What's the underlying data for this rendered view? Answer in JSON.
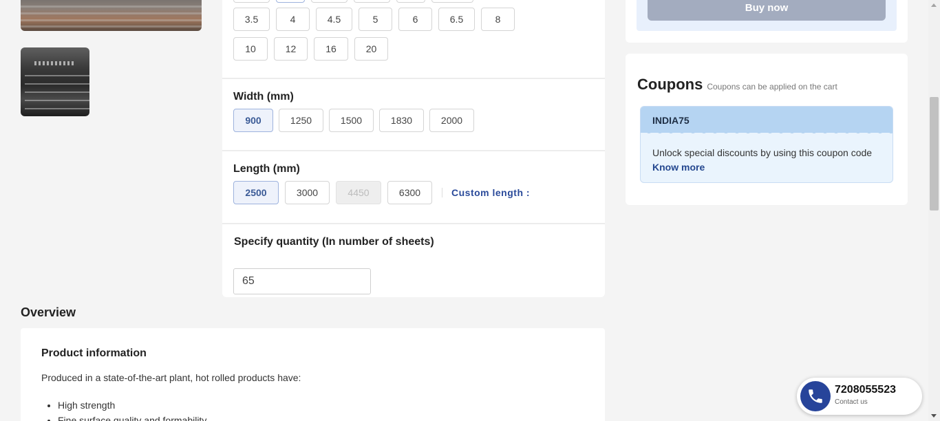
{
  "thickness": {
    "options_row1": [
      "3.5",
      "4",
      "4.5",
      "5",
      "6",
      "6.5",
      "8"
    ],
    "options_row2": [
      "10",
      "12",
      "16",
      "20"
    ]
  },
  "width": {
    "title": "Width (mm)",
    "options": [
      "900",
      "1250",
      "1500",
      "1830",
      "2000"
    ],
    "selected": "900"
  },
  "length": {
    "title": "Length (mm)",
    "options": [
      "2500",
      "3000",
      "4450",
      "6300"
    ],
    "selected": "2500",
    "disabled": "4450",
    "custom_label": "Custom length :"
  },
  "quantity": {
    "title": "Specify quantity (In number of sheets)",
    "value": "65"
  },
  "buy": {
    "label": "Buy now"
  },
  "coupons": {
    "title": "Coupons",
    "subtitle": "Coupons can be applied on the cart",
    "code": "INDIA75",
    "description": "Unlock special discounts by using this coupon code",
    "link": "Know more"
  },
  "overview": {
    "title": "Overview",
    "heading": "Product information",
    "intro": "Produced in a state-of-the-art plant, hot rolled products have:",
    "bullets": [
      "High strength",
      "Fine surface quality and formability"
    ]
  },
  "contact": {
    "number": "7208055523",
    "label": "Contact us"
  },
  "colors": {
    "accent": "#27449a",
    "selected_bg": "#eef2fb",
    "coupon_header": "#b5d4f2",
    "buy_disabled": "#a3acbf"
  }
}
